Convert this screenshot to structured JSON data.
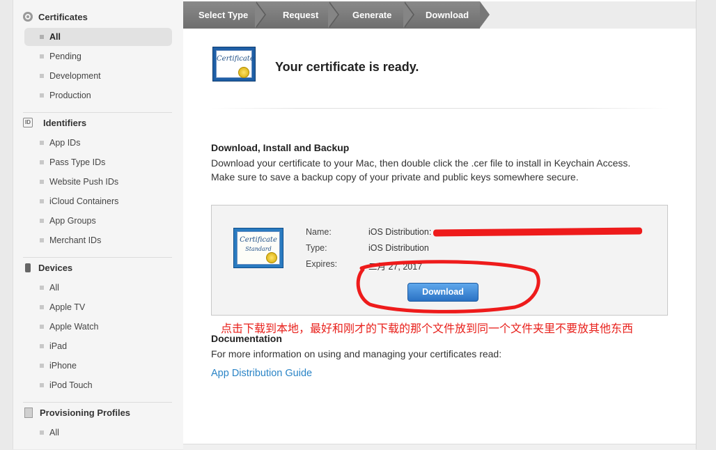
{
  "sidebar": {
    "certificates": {
      "title": "Certificates",
      "icon": "gear-icon",
      "items": [
        "All",
        "Pending",
        "Development",
        "Production"
      ]
    },
    "identifiers": {
      "title": "Identifiers",
      "icon_text": "ID",
      "items": [
        "App IDs",
        "Pass Type IDs",
        "Website Push IDs",
        "iCloud Containers",
        "App Groups",
        "Merchant IDs"
      ]
    },
    "devices": {
      "title": "Devices",
      "icon": "iphone-icon",
      "items": [
        "All",
        "Apple TV",
        "Apple Watch",
        "iPad",
        "iPhone",
        "iPod Touch"
      ]
    },
    "profiles": {
      "title": "Provisioning Profiles",
      "icon": "document-icon",
      "items": [
        "All"
      ]
    }
  },
  "steps": [
    "Select Type",
    "Request",
    "Generate",
    "Download"
  ],
  "main": {
    "ready_title": "Your certificate is ready.",
    "cert_icon_text": "Certificate",
    "cert_icon_subtext": "Standard",
    "download_section_title": "Download, Install and Backup",
    "download_section_text": "Download your certificate to your Mac, then double click the .cer file to install in Keychain Access. Make sure to save a backup copy of your private and public keys somewhere secure.",
    "cert_info": {
      "name_label": "Name:",
      "name_value": "iOS Distribution:",
      "type_label": "Type:",
      "type_value": "iOS Distribution",
      "expires_label": "Expires:",
      "expires_value": "二月 27, 2017"
    },
    "download_button": "Download",
    "annotation": "点击下载到本地，最好和刚才的下载的那个文件放到同一个文件夹里不要放其他东西",
    "doc_title": "Documentation",
    "doc_text": "For more information on using and managing your certificates read:",
    "doc_link": "App Distribution Guide"
  },
  "colors": {
    "annotation_red": "#e8201b",
    "link_blue": "#2a84c6",
    "step_bar": "#7a7a7a",
    "button_blue": "#2b72c4"
  }
}
